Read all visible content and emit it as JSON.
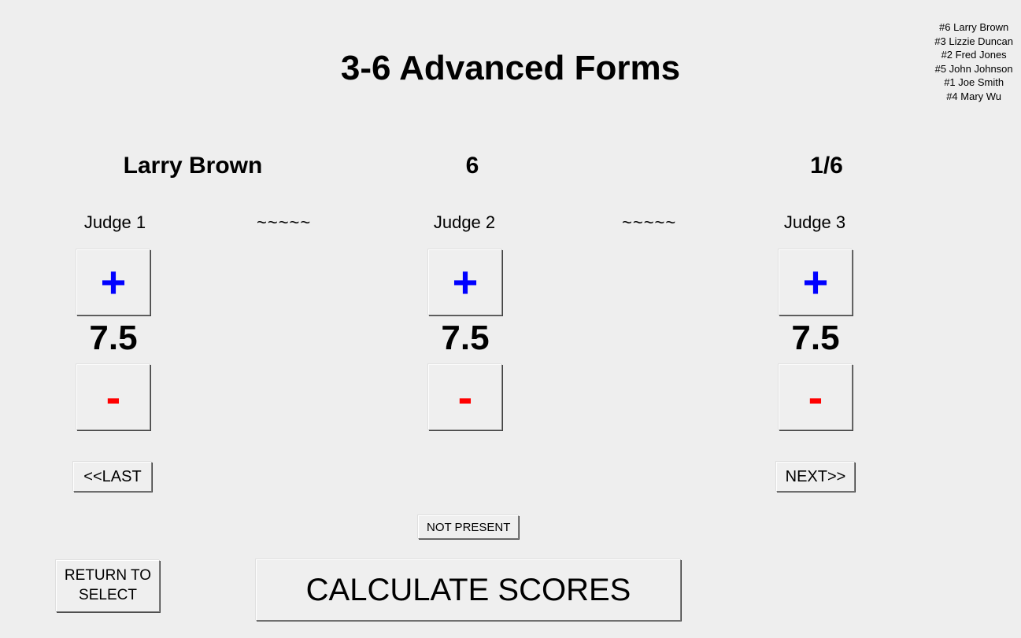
{
  "title": "3-6 Advanced Forms",
  "roster": [
    "#6  Larry Brown",
    "#3  Lizzie Duncan",
    "#2  Fred Jones",
    "#5  John Johnson",
    "#1  Joe Smith",
    "#4  Mary Wu"
  ],
  "competitor": {
    "name": "Larry Brown",
    "number": "6",
    "position": "1/6"
  },
  "judges": {
    "labels": {
      "j1": "Judge 1",
      "j2": "Judge 2",
      "j3": "Judge 3"
    },
    "separator": "~~~~~",
    "plus_glyph": "+",
    "minus_glyph": "-"
  },
  "scores": {
    "s1": "7.5",
    "s2": "7.5",
    "s3": "7.5"
  },
  "nav": {
    "last": "<<LAST",
    "next": "NEXT>>"
  },
  "buttons": {
    "not_present": "NOT PRESENT",
    "return": "RETURN\nTO SELECT",
    "calculate": "CALCULATE SCORES"
  }
}
